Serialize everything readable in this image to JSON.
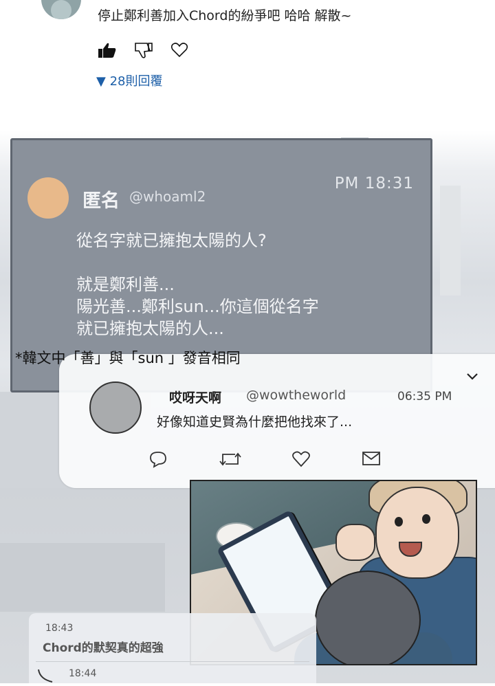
{
  "top_comment": {
    "text": "停止鄭利善加入Chord的紛爭吧 哈哈 解散~",
    "like_icon": "thumbs-up-filled",
    "dislike_icon": "thumbs-down-outline",
    "heart_icon": "heart-outline",
    "replies_label": "▼ 28則回覆"
  },
  "dark_tweet": {
    "name": "匿名",
    "handle": "@whoaml2",
    "time": "PM 18:31",
    "body": "從名字就已擁抱太陽的人?\n\n就是鄭利善...\n陽光善...鄭利sun...你這個從名字\n就已擁抱太陽的人..."
  },
  "translator_note": "*韓文中「善」與「sun 」發音相同",
  "white_tweet": {
    "name": "哎呀天啊",
    "handle": "@wowtheworld",
    "time": "06:35 PM",
    "text": "好像知道史賢為什麼把他找來了...",
    "actions": [
      "reply-icon",
      "retweet-icon",
      "heart-icon",
      "mail-icon"
    ]
  },
  "chat": {
    "time1": "18:43",
    "message1": "Chord的默契真的超強",
    "time2": "18:44"
  },
  "colors": {
    "link_blue": "#1d5fa8",
    "dark_card": "#8a919b",
    "avatar_orange": "#e8b98a"
  }
}
